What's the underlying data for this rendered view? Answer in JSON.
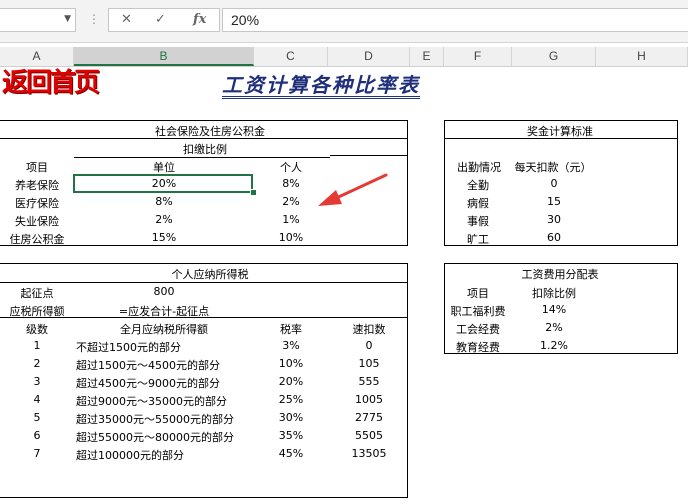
{
  "formula_bar": {
    "cancel_icon": "✕",
    "enter_icon": "✓",
    "fx_label": "fx",
    "value": "20%"
  },
  "columns": [
    "A",
    "B",
    "C",
    "D",
    "E",
    "F",
    "G",
    "H"
  ],
  "return_link": "返回首页",
  "title": "工资计算各种比率表",
  "social_insurance": {
    "heading": "社会保险及住房公积金",
    "sub_heading": "扣缴比例",
    "col_item": "项目",
    "col_unit": "单位",
    "col_personal": "个人",
    "rows": [
      {
        "item": "养老保险",
        "unit": "20%",
        "personal": "8%"
      },
      {
        "item": "医疗保险",
        "unit": "8%",
        "personal": "2%"
      },
      {
        "item": "失业保险",
        "unit": "2%",
        "personal": "1%"
      },
      {
        "item": "住房公积金",
        "unit": "15%",
        "personal": "10%"
      }
    ]
  },
  "bonus": {
    "heading": "奖金计算标准",
    "col_attendance": "出勤情况",
    "col_deduction": "每天扣款（元）",
    "rows": [
      {
        "status": "全勤",
        "amount": "0"
      },
      {
        "status": "病假",
        "amount": "15"
      },
      {
        "status": "事假",
        "amount": "30"
      },
      {
        "status": "旷工",
        "amount": "60"
      }
    ]
  },
  "tax": {
    "heading": "个人应纳所得税",
    "threshold_label": "起征点",
    "threshold_value": "800",
    "taxable_label": "应税所得额",
    "taxable_formula": "=应发合计-起征点",
    "col_level": "级数",
    "col_bracket": "全月应纳税所得额",
    "col_rate": "税率",
    "col_quick": "速扣数",
    "rows": [
      {
        "level": "1",
        "bracket": "不超过1500元的部分",
        "rate": "3%",
        "quick": "0"
      },
      {
        "level": "2",
        "bracket": "超过1500元～4500元的部分",
        "rate": "10%",
        "quick": "105"
      },
      {
        "level": "3",
        "bracket": "超过4500元～9000元的部分",
        "rate": "20%",
        "quick": "555"
      },
      {
        "level": "4",
        "bracket": "超过9000元～35000元的部分",
        "rate": "25%",
        "quick": "1005"
      },
      {
        "level": "5",
        "bracket": "超过35000元～55000元的部分",
        "rate": "30%",
        "quick": "2775"
      },
      {
        "level": "6",
        "bracket": "超过55000元～80000元的部分",
        "rate": "35%",
        "quick": "5505"
      },
      {
        "level": "7",
        "bracket": "超过100000元的部分",
        "rate": "45%",
        "quick": "13505"
      }
    ]
  },
  "wage_fee": {
    "heading": "工资费用分配表",
    "col_item": "项目",
    "col_ratio": "扣除比例",
    "rows": [
      {
        "item": "职工福利费",
        "ratio": "14%"
      },
      {
        "item": "工会经费",
        "ratio": "2%"
      },
      {
        "item": "教育经费",
        "ratio": "1.2%"
      }
    ]
  },
  "colors": {
    "selection": "#217346",
    "title": "#1f2f7a",
    "return_link": "#e00000",
    "arrow": "#e53935"
  }
}
